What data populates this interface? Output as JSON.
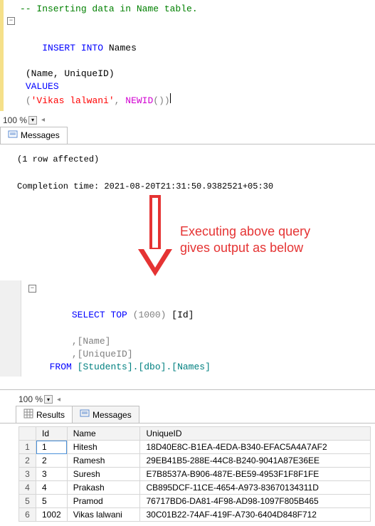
{
  "editor1": {
    "comment": "-- Inserting data in Name table.",
    "insert_into": "INSERT INTO",
    "table": "Names",
    "cols": "(Name, UniqueID)",
    "values_kw": "VALUES",
    "string_val": "'Vikas lalwani'",
    "newid": "NEWID",
    "paren_open": "(",
    "paren_close": "())"
  },
  "zoom": {
    "value": "100 %"
  },
  "messages_tab": {
    "label": "Messages"
  },
  "output": {
    "rows_affected": "(1 row affected)",
    "completion": "Completion time: 2021-08-20T21:31:50.9382521+05:30"
  },
  "annotation": {
    "line1": "Executing above query",
    "line2": "gives output as below"
  },
  "editor2": {
    "select_kw": "SELECT",
    "top_kw": "TOP",
    "top_n": "(1000)",
    "id_col": "[Id]",
    "name_col": ",[Name]",
    "uid_col": ",[UniqueID]",
    "from_kw": "FROM",
    "from_path": "[Students].[dbo].[Names]"
  },
  "zoom2": {
    "value": "100 %"
  },
  "results_tab": {
    "label": "Results"
  },
  "messages_tab2": {
    "label": "Messages"
  },
  "chart_data": {
    "type": "table",
    "columns": [
      "Id",
      "Name",
      "UniqueID"
    ],
    "rows": [
      {
        "Id": "1",
        "Name": "Hitesh",
        "UniqueID": "18D40E8C-B1EA-4EDA-B340-EFAC5A4A7AF2"
      },
      {
        "Id": "2",
        "Name": "Ramesh",
        "UniqueID": "29EB41B5-288E-44C8-B240-9041A87E36EE"
      },
      {
        "Id": "3",
        "Name": "Suresh",
        "UniqueID": "E7B8537A-B906-487E-BE59-4953F1F8F1FE"
      },
      {
        "Id": "4",
        "Name": "Prakash",
        "UniqueID": "CB895DCF-11CE-4654-A973-83670134311D"
      },
      {
        "Id": "5",
        "Name": "Pramod",
        "UniqueID": "76717BD6-DA81-4F98-AD98-1097F805B465"
      },
      {
        "Id": "1002",
        "Name": "Vikas lalwani",
        "UniqueID": "30C01B22-74AF-419F-A730-6404D848F712"
      }
    ]
  }
}
